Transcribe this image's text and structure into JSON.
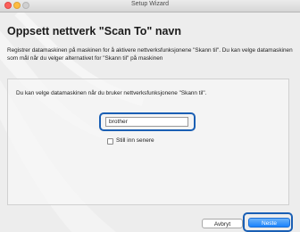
{
  "window": {
    "title": "Setup Wizard",
    "controls": [
      "close",
      "minimize",
      "zoom"
    ]
  },
  "page": {
    "heading": "Oppsett nettverk \"Scan To\" navn",
    "description": "Registrer datamaskinen på maskinen for å aktivere nettverksfunksjonene \"Skann til\". Du kan velge datamaskinen som mål når du velger alternativet for \"Skann til\" på maskinen"
  },
  "panel": {
    "text": "Du kan velge datamaskinen når du bruker nettverksfunksjonene \"Skann til\".",
    "name_field_value": "brother",
    "checkbox_label": "Still inn senere",
    "checkbox_checked": false
  },
  "buttons": {
    "cancel_label": "Avbryt",
    "next_label": "Neste"
  },
  "colors": {
    "highlight_ring": "#1a5fb4",
    "primary_button": "#1a82fb"
  }
}
